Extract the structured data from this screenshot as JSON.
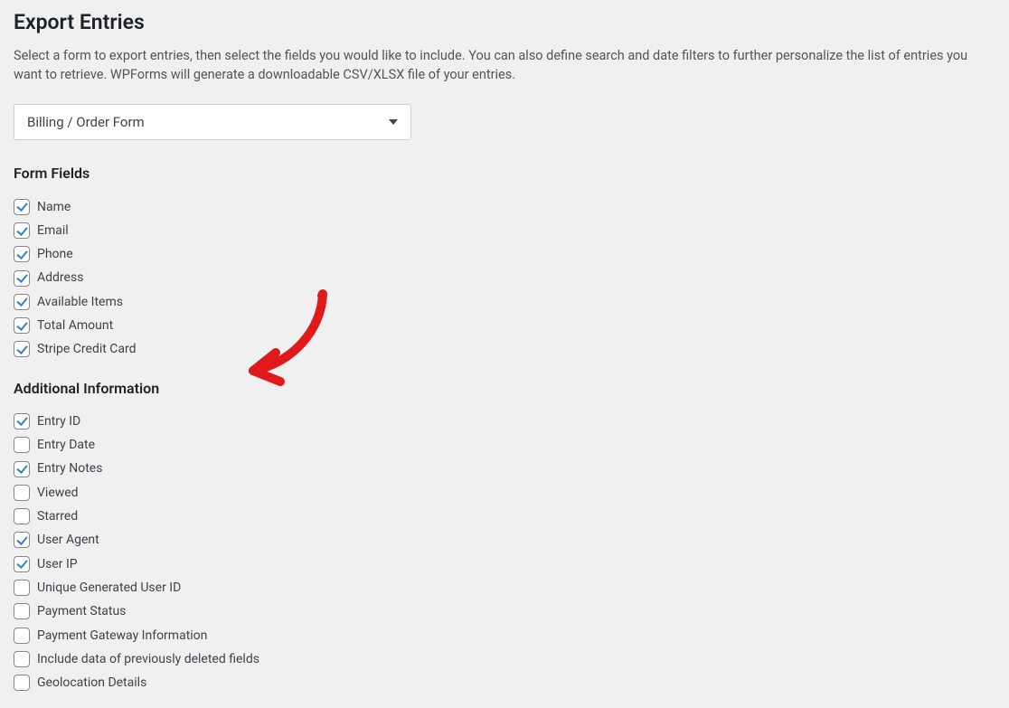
{
  "title": "Export Entries",
  "description": "Select a form to export entries, then select the fields you would like to include. You can also define search and date filters to further personalize the list of entries you want to retrieve. WPForms will generate a downloadable CSV/XLSX file of your entries.",
  "form_select": {
    "value": "Billing / Order Form"
  },
  "form_fields": {
    "heading": "Form Fields",
    "items": [
      {
        "label": "Name",
        "checked": true
      },
      {
        "label": "Email",
        "checked": true
      },
      {
        "label": "Phone",
        "checked": true
      },
      {
        "label": "Address",
        "checked": true
      },
      {
        "label": "Available Items",
        "checked": true
      },
      {
        "label": "Total Amount",
        "checked": true
      },
      {
        "label": "Stripe Credit Card",
        "checked": true
      }
    ]
  },
  "additional_info": {
    "heading": "Additional Information",
    "items": [
      {
        "label": "Entry ID",
        "checked": true
      },
      {
        "label": "Entry Date",
        "checked": false
      },
      {
        "label": "Entry Notes",
        "checked": true
      },
      {
        "label": "Viewed",
        "checked": false
      },
      {
        "label": "Starred",
        "checked": false
      },
      {
        "label": "User Agent",
        "checked": true
      },
      {
        "label": "User IP",
        "checked": true
      },
      {
        "label": "Unique Generated User ID",
        "checked": false
      },
      {
        "label": "Payment Status",
        "checked": false
      },
      {
        "label": "Payment Gateway Information",
        "checked": false
      },
      {
        "label": "Include data of previously deleted fields",
        "checked": false
      },
      {
        "label": "Geolocation Details",
        "checked": false
      }
    ]
  }
}
